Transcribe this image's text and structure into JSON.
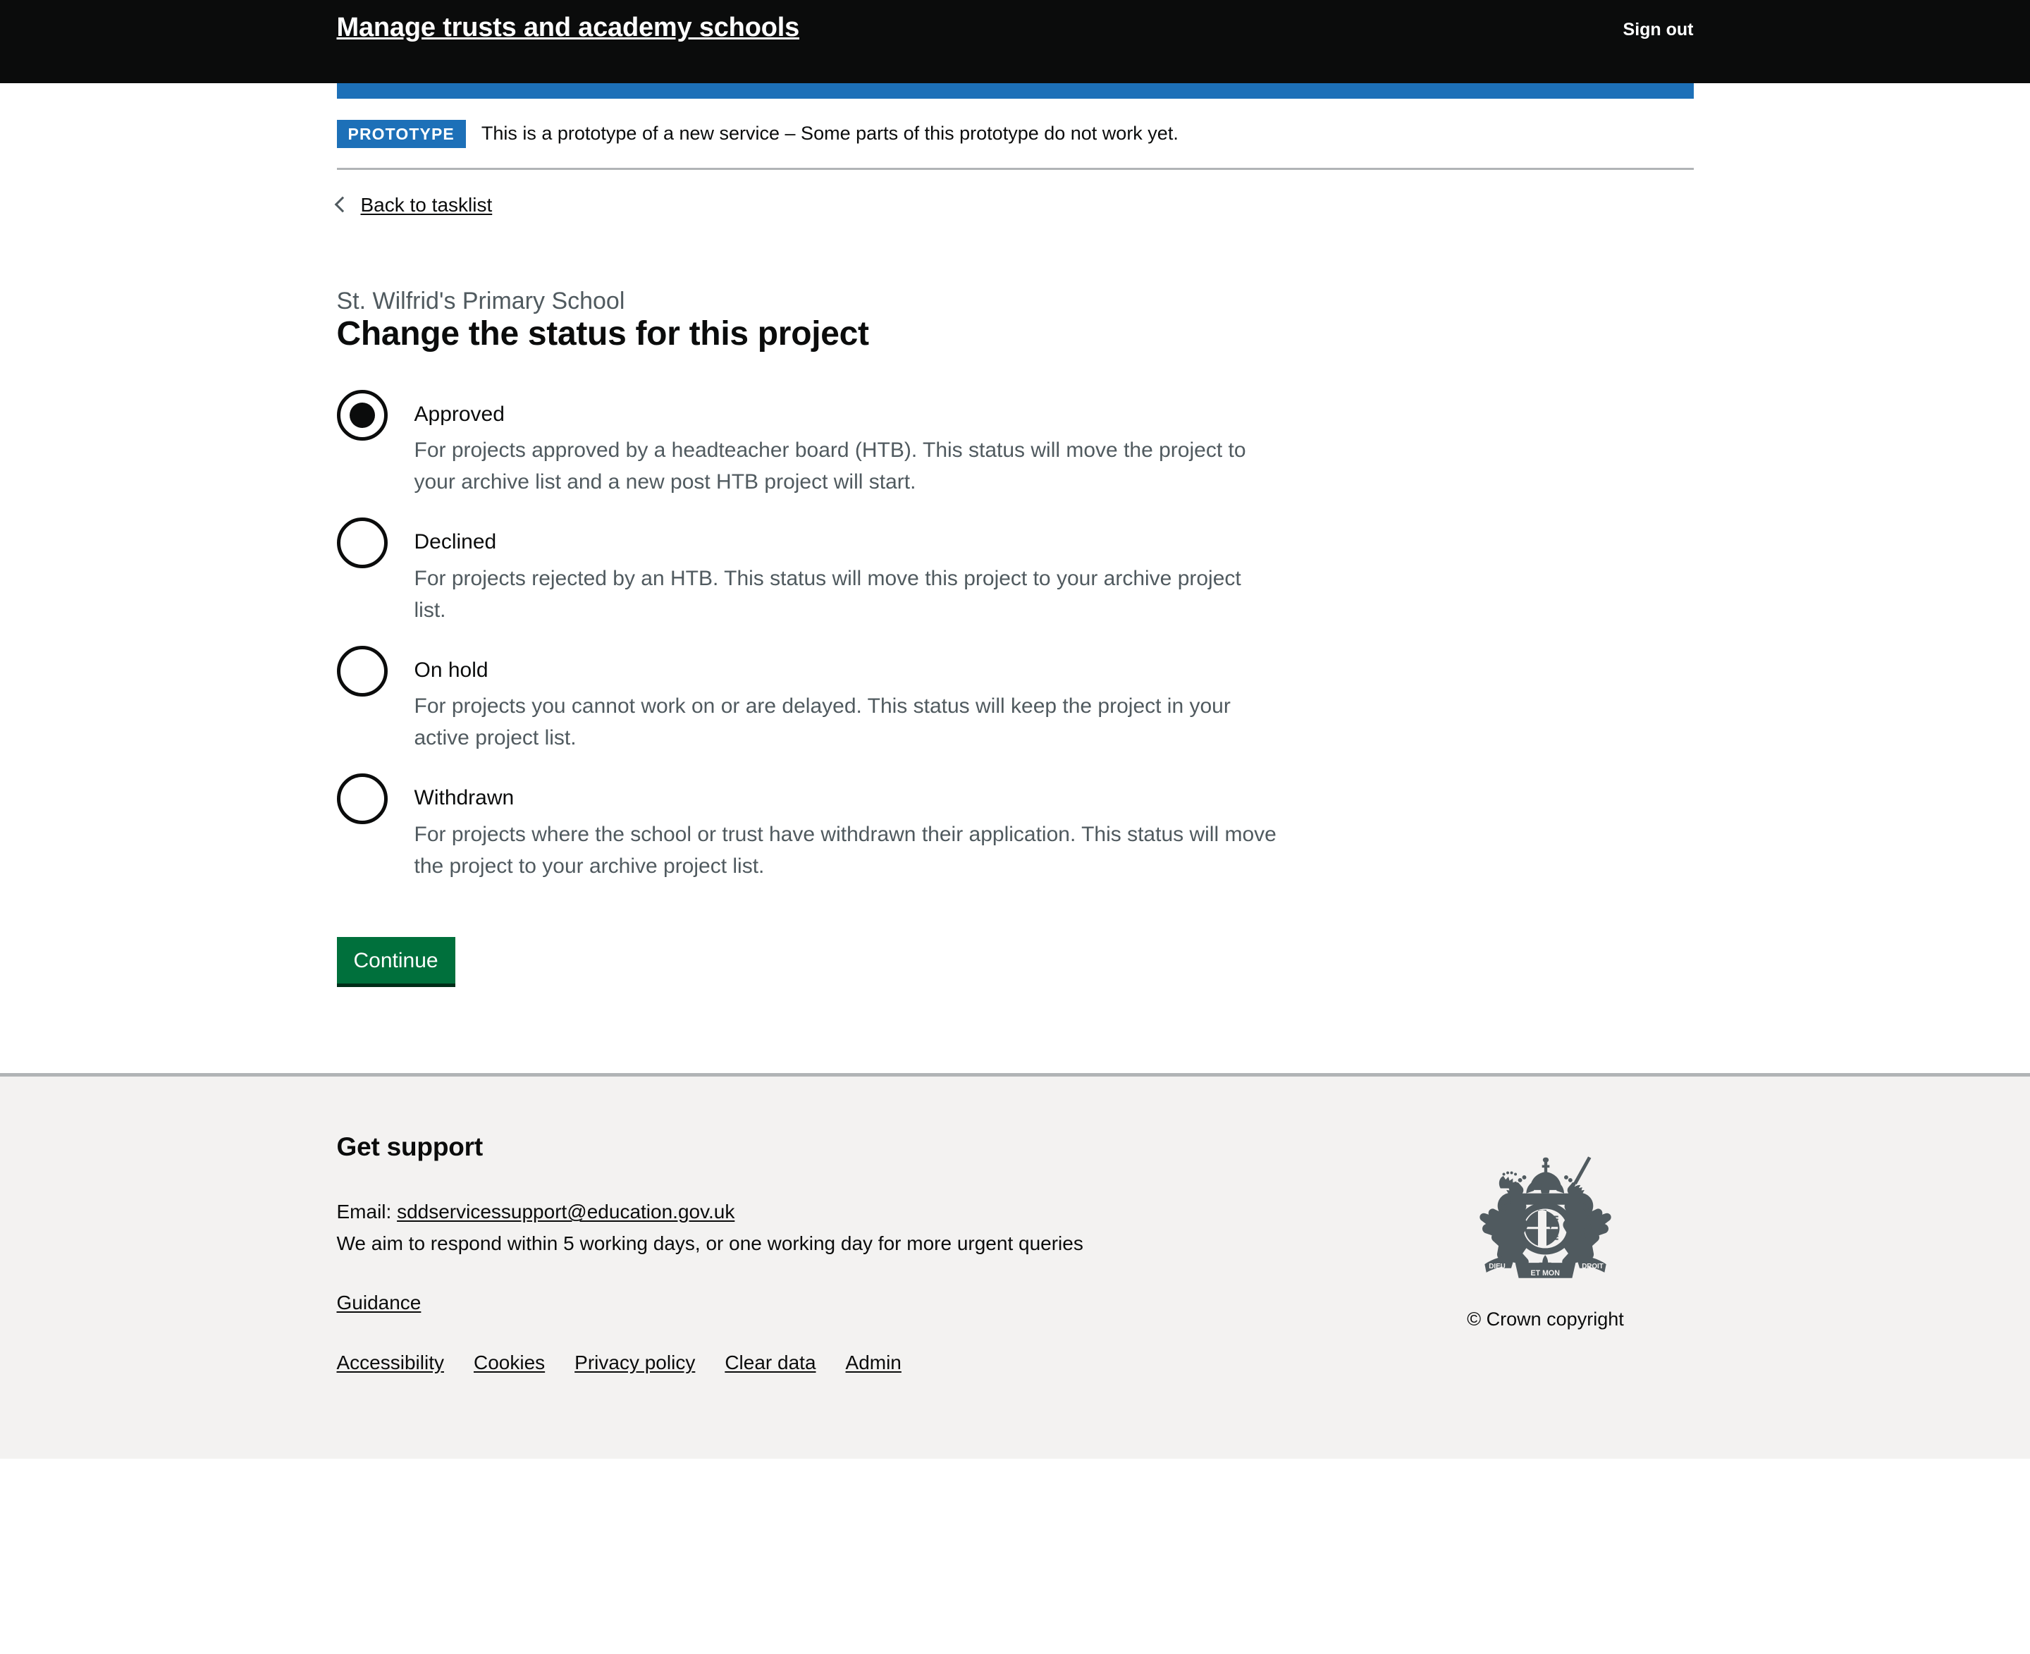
{
  "header": {
    "service_name": "Manage trusts and academy schools",
    "sign_out_label": "Sign out"
  },
  "phase_banner": {
    "tag": "PROTOTYPE",
    "text": "This is a prototype of a new service – Some parts of this prototype do not work yet."
  },
  "back_link": {
    "label": "Back to tasklist",
    "icon": "chevron-left-icon"
  },
  "page": {
    "caption": "St. Wilfrid's Primary School",
    "title": "Change the status for this project"
  },
  "radios": {
    "selected_value": "approved",
    "options": [
      {
        "value": "approved",
        "label": "Approved",
        "hint": "For projects approved by a headteacher board (HTB). This status will move the project to your archive list and a new post HTB project will start.",
        "checked": true
      },
      {
        "value": "declined",
        "label": "Declined",
        "hint": "For projects rejected by an HTB. This status will move this project to your archive project list.",
        "checked": false
      },
      {
        "value": "on-hold",
        "label": "On hold",
        "hint": "For projects you cannot work on or are delayed. This status will keep the project in your active project list.",
        "checked": false
      },
      {
        "value": "withdrawn",
        "label": "Withdrawn",
        "hint": "For projects where the school or trust have withdrawn their application. This status will move the project to your archive project list.",
        "checked": false
      }
    ]
  },
  "actions": {
    "continue_label": "Continue"
  },
  "footer": {
    "heading": "Get support",
    "email_prefix": "Email:",
    "email_address": "sddservicessupport@education.gov.uk",
    "response_time": "We aim to respond within 5 working days, or one working day for more urgent queries",
    "guidance_label": "Guidance",
    "links": [
      {
        "label": "Accessibility"
      },
      {
        "label": "Cookies"
      },
      {
        "label": "Privacy policy"
      },
      {
        "label": "Clear data"
      },
      {
        "label": "Admin"
      }
    ],
    "crown_copyright": "© Crown copyright",
    "crown_icon": "royal-coat-of-arms-icon"
  },
  "colors": {
    "header_background": "#0b0c0c",
    "accent_blue": "#1d70b8",
    "button_green": "#00703c",
    "button_green_shadow": "#002d18",
    "footer_background": "#f3f2f1",
    "muted_text": "#505a5f",
    "border_grey": "#b1b4b6"
  }
}
